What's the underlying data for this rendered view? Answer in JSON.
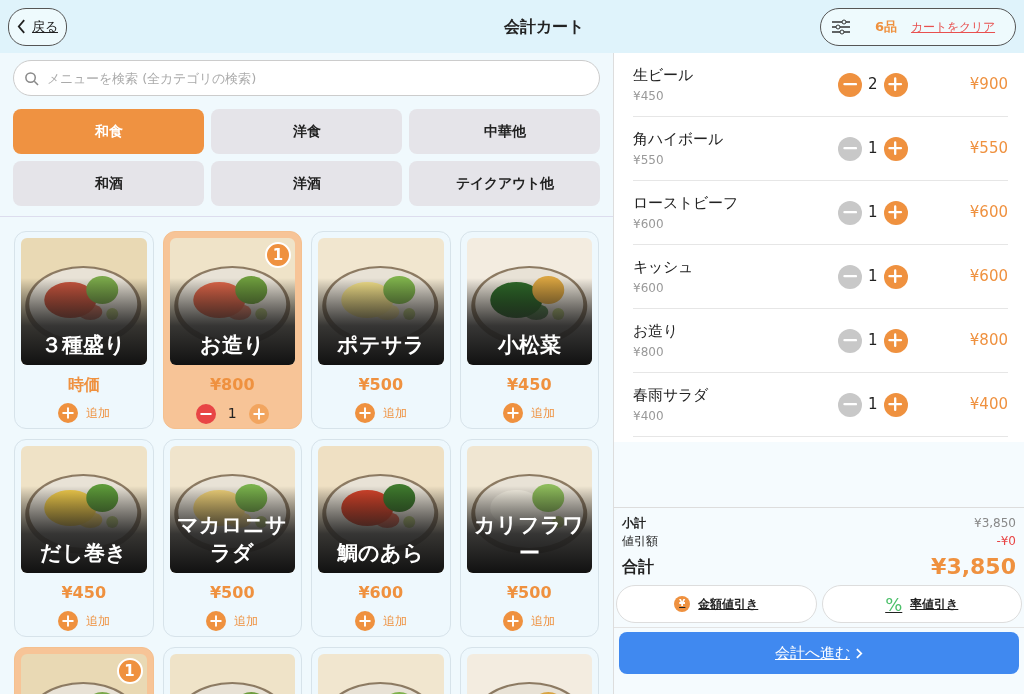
{
  "header": {
    "back_label": "戻る",
    "title": "会計カート",
    "item_count": "6品",
    "clear_label": "カートをクリア"
  },
  "search": {
    "placeholder": "メニューを検索 (全カテゴリの検索)"
  },
  "categories": [
    {
      "label": "和食",
      "selected": true
    },
    {
      "label": "洋食",
      "selected": false
    },
    {
      "label": "中華他",
      "selected": false
    },
    {
      "label": "和酒",
      "selected": false
    },
    {
      "label": "洋酒",
      "selected": false
    },
    {
      "label": "テイクアウト他",
      "selected": false
    }
  ],
  "menu_items": [
    {
      "name": "３種盛り",
      "price": "時価",
      "in_cart": false,
      "add_label": "追加"
    },
    {
      "name": "お造り",
      "price": "¥800",
      "in_cart": true,
      "badge": "1",
      "quantity": "1"
    },
    {
      "name": "ポテサラ",
      "price": "¥500",
      "in_cart": false,
      "add_label": "追加"
    },
    {
      "name": "小松菜",
      "price": "¥450",
      "in_cart": false,
      "add_label": "追加"
    },
    {
      "name": "だし巻き",
      "price": "¥450",
      "in_cart": false,
      "add_label": "追加"
    },
    {
      "name": "マカロニサラダ",
      "price": "¥500",
      "in_cart": false,
      "add_label": "追加"
    },
    {
      "name": "鯛のあら",
      "price": "¥600",
      "in_cart": false,
      "add_label": "追加"
    },
    {
      "name": "カリフラワー",
      "price": "¥500",
      "in_cart": false,
      "add_label": "追加"
    },
    {
      "in_cart": true,
      "badge": "1"
    },
    {
      "in_cart": false
    },
    {
      "in_cart": false
    },
    {
      "in_cart": false
    }
  ],
  "cart": [
    {
      "name": "生ビール",
      "unit_price": "¥450",
      "quantity": "2",
      "can_decrease": true,
      "total": "¥900"
    },
    {
      "name": "角ハイボール",
      "unit_price": "¥550",
      "quantity": "1",
      "can_decrease": false,
      "total": "¥550"
    },
    {
      "name": "ローストビーフ",
      "unit_price": "¥600",
      "quantity": "1",
      "can_decrease": false,
      "total": "¥600"
    },
    {
      "name": "キッシュ",
      "unit_price": "¥600",
      "quantity": "1",
      "can_decrease": false,
      "total": "¥600"
    },
    {
      "name": "お造り",
      "unit_price": "¥800",
      "quantity": "1",
      "can_decrease": false,
      "total": "¥800"
    },
    {
      "name": "春雨サラダ",
      "unit_price": "¥400",
      "quantity": "1",
      "can_decrease": false,
      "total": "¥400"
    }
  ],
  "summary": {
    "subtotal_label": "小計",
    "subtotal": "¥3,850",
    "discount_label": "値引額",
    "discount": "-¥0",
    "total_label": "合計",
    "total": "¥3,850"
  },
  "discount_buttons": [
    {
      "kind": "amount",
      "glyph": "¥",
      "label": "金額値引き"
    },
    {
      "kind": "rate",
      "glyph": "%",
      "label": "率値引き"
    }
  ],
  "checkout": {
    "label": "会計へ進む"
  }
}
